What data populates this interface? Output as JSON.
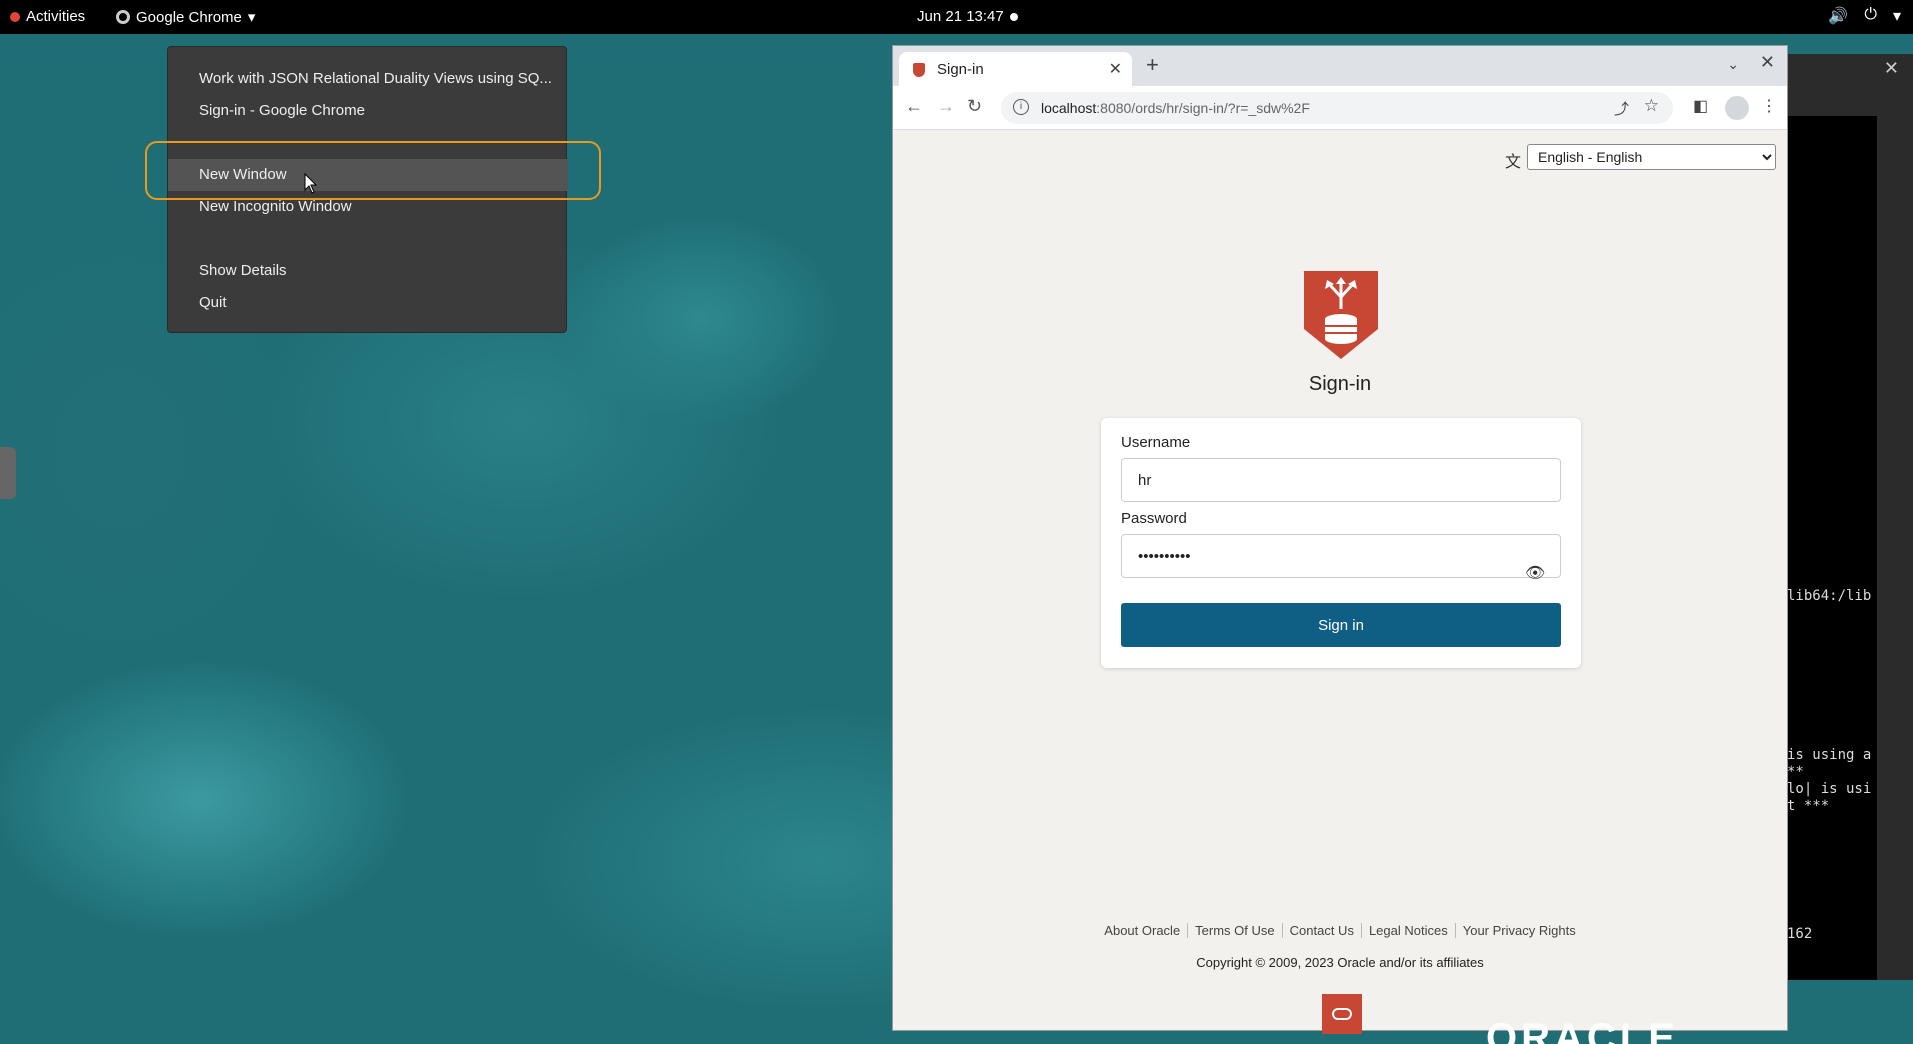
{
  "topbar": {
    "activities": "Activities",
    "app_name": "Google Chrome",
    "clock": "Jun 21  13:47"
  },
  "app_menu": {
    "items": [
      "Work with JSON Relational Duality Views using SQ...",
      "Sign-in - Google Chrome",
      "New Window",
      "New Incognito Window",
      "Show Details",
      "Quit"
    ],
    "highlighted": "New Window"
  },
  "terminal": {
    "lines": [
      "lib64:/lib",
      "is using a",
      "**",
      "lo| is usi",
      "t ***",
      "162"
    ]
  },
  "browser": {
    "tab_title": "Sign-in",
    "url_host": "localhost",
    "url_path": ":8080/ords/hr/sign-in/?r=_sdw%2F"
  },
  "page": {
    "language_selected": "English - English",
    "title": "Sign-in",
    "username_label": "Username",
    "username_value": "hr",
    "password_label": "Password",
    "password_value": "••••••••••",
    "signin_button": "Sign in",
    "footer_links": [
      "About Oracle",
      "Terms Of Use",
      "Contact Us",
      "Legal Notices",
      "Your Privacy Rights"
    ],
    "copyright": "Copyright © 2009, 2023 Oracle and/or its affiliates",
    "brand_word": "ORACLE"
  },
  "colors": {
    "oracle_red": "#c74634",
    "button_blue": "#0f5f85",
    "highlight_orange": "#e89a1c"
  }
}
